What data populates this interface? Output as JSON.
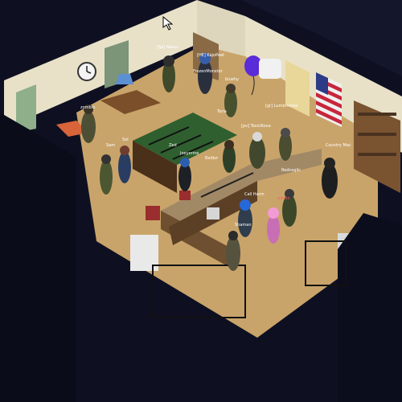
{
  "game": {
    "title": "",
    "world": {
      "view": "isometric",
      "time_of_day": "night",
      "location": "gun shop interior"
    },
    "colors": {
      "night_floor": "#0e1022",
      "wood_floor": "#c9a46a",
      "wall": "#e8e1c8",
      "felt_table": "#2f5f2f",
      "counter": "#6e5030",
      "player_name": "#ffffff",
      "highlight_name": "#ff5a5a"
    },
    "icons": [
      "wall-clock-icon",
      "american-flag-icon",
      "balloon-icon",
      "mouse-cursor-icon"
    ],
    "player_names": [
      "[Sp] Nasus",
      "[HE] KajoPeet",
      "FrozenMonster",
      "bluehy",
      "Toria",
      "[gr] Lumbrvinka",
      "[pv] ToxicNova",
      "zombie",
      "Sol",
      "Sam",
      "Zed",
      "Joeyerine",
      "Country Mac",
      "Rednsglic",
      "Call Harm",
      "admin",
      "Shaman",
      "Baldur"
    ]
  }
}
